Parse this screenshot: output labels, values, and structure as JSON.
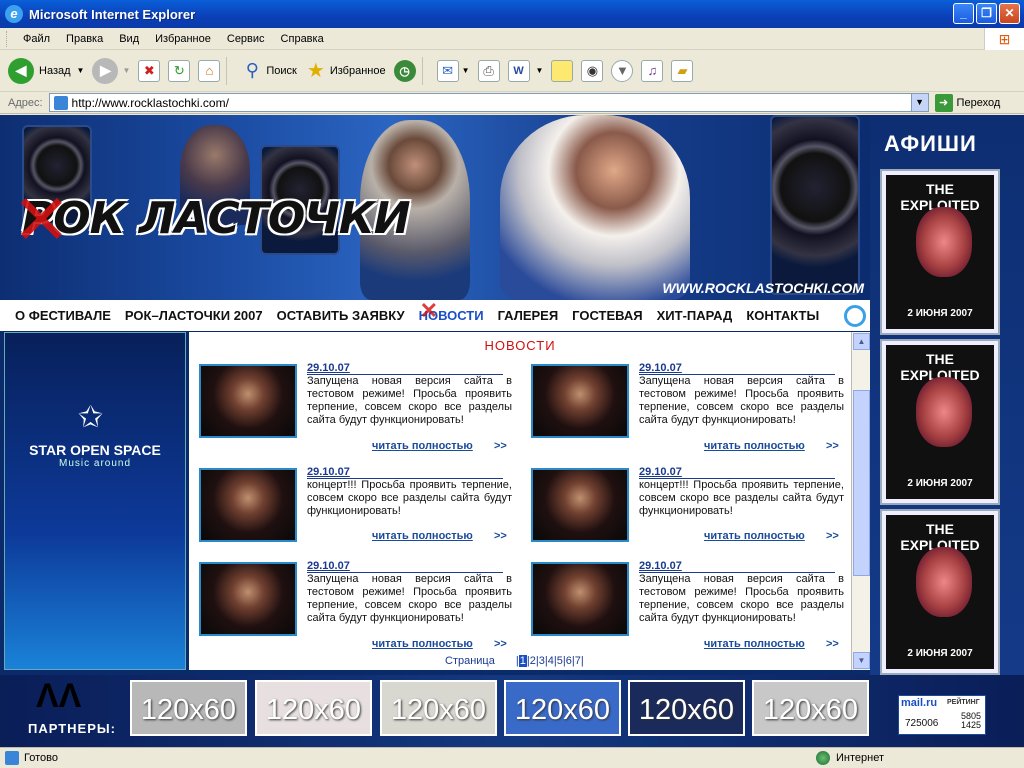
{
  "window": {
    "title": "Microsoft Internet Explorer"
  },
  "menu": [
    "Файл",
    "Правка",
    "Вид",
    "Избранное",
    "Сервис",
    "Справка"
  ],
  "toolbar": {
    "back_label": "Назад",
    "search_label": "Поиск",
    "favorites_label": "Избранное"
  },
  "address": {
    "label": "Адрес:",
    "url": "http://www.rocklastochki.com/",
    "go_label": "Переход"
  },
  "site": {
    "logo_text": "РОК ЛАСТОЧКИ",
    "site_url": "WWW.ROCKLASTOCHKI.COM",
    "nav": [
      "О ФЕСТИВАЛЕ",
      "РОК–ЛАСТОЧКИ 2007",
      "ОСТАВИТЬ ЗАЯВКУ",
      "НОВОСТИ",
      "ГАЛЕРЕЯ",
      "ГОСТЕВАЯ",
      "ХИТ-ПАРАД",
      "КОНТАКТЫ"
    ],
    "left_ad": {
      "title": "STAR OPEN SPACE",
      "subtitle": "Music around"
    },
    "afishi": {
      "title": "АФИШИ",
      "posters": [
        {
          "band": "THE EXPLOITED",
          "date": "2 ИЮНЯ 2007"
        },
        {
          "band": "THE EXPLOITED",
          "date": "2 ИЮНЯ 2007"
        },
        {
          "band": "THE EXPLOITED",
          "date": "2 ИЮНЯ 2007"
        }
      ]
    },
    "news_title": "НОВОСТИ",
    "news": [
      {
        "date": "29.10.07",
        "text": "Запущена новая версия сайта в тестовом режиме! Просьба проявить терпение, совсем скоро все разделы сайта будут функционировать!",
        "more": "читать полностью",
        "arrow": ">>"
      },
      {
        "date": "29.10.07",
        "text": "Запущена новая версия сайта в тестовом режиме! Просьба проявить терпение, совсем скоро все разделы сайта будут функционировать!",
        "more": "читать полностью",
        "arrow": ">>"
      },
      {
        "date": "29.10.07",
        "text": "концерт!!! Просьба проявить терпение, совсем скоро все разделы сайта будут функционировать!",
        "more": "читать полностью",
        "arrow": ">>"
      },
      {
        "date": "29.10.07",
        "text": "концерт!!! Просьба проявить терпение, совсем скоро все разделы сайта будут функционировать!",
        "more": "читать полностью",
        "arrow": ">>"
      },
      {
        "date": "29.10.07",
        "text": "Запущена новая версия сайта в тестовом режиме! Просьба проявить терпение, совсем скоро все разделы сайта будут функционировать!",
        "more": "читать полностью",
        "arrow": ">>"
      },
      {
        "date": "29.10.07",
        "text": "Запущена новая версия сайта в тестовом режиме! Просьба проявить терпение, совсем скоро все разделы сайта будут функционировать!",
        "more": "читать полностью",
        "arrow": ">>"
      }
    ],
    "pager": {
      "label": "Страница",
      "pages": [
        "1",
        "2",
        "3",
        "4",
        "5",
        "6",
        "7"
      ],
      "current": "1"
    },
    "partners": {
      "label": "ПАРТНЕРЫ:",
      "boxes": [
        "120x60",
        "120x60",
        "120x60",
        "120x60",
        "120x60",
        "120x60"
      ]
    },
    "rating": {
      "brand": "mail.ru",
      "label": "РЕЙТИНГ",
      "count": "725006",
      "v1": "5805",
      "v2": "1425"
    }
  },
  "status": {
    "left": "Готово",
    "zone": "Интернет"
  },
  "colors": {
    "accent": "#1a4fc4",
    "red": "#d01010",
    "bg": "#0a2a6a"
  }
}
